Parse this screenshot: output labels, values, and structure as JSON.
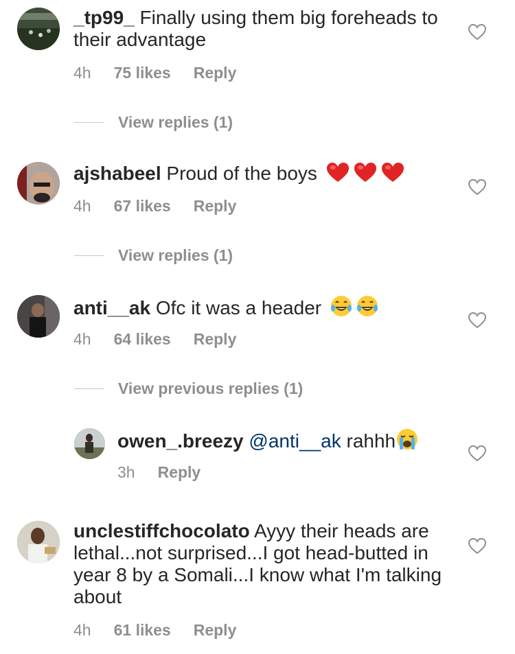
{
  "comments": [
    {
      "username": "_tp99_",
      "text": "Finally using them big foreheads to their advantage",
      "age": "4h",
      "likes": "75 likes",
      "reply": "Reply",
      "view_replies": "View replies (1)",
      "avatar_colors": [
        "#2c3b2a",
        "#7a8a73"
      ]
    },
    {
      "username": "ajshabeel",
      "text": "Proud of the boys",
      "emojis": [
        "red-heart",
        "red-heart",
        "red-heart"
      ],
      "age": "4h",
      "likes": "67 likes",
      "reply": "Reply",
      "view_replies": "View replies (1)",
      "avatar_colors": [
        "#b8ada6",
        "#2b2321"
      ]
    },
    {
      "username": "anti__ak",
      "text": "Ofc it was a header",
      "emojis": [
        "tears-of-joy",
        "tears-of-joy"
      ],
      "age": "4h",
      "likes": "64 likes",
      "reply": "Reply",
      "view_replies": "View previous replies (1)",
      "avatar_colors": [
        "#3a3636",
        "#151515"
      ]
    },
    {
      "username": "owen_.breezy",
      "mention": "@anti__ak",
      "text": "rahhh",
      "emojis": [
        "loudly-crying"
      ],
      "age": "3h",
      "reply": "Reply",
      "avatar_colors": [
        "#c9d0cf",
        "#3b3f2c"
      ]
    },
    {
      "username": "unclestiffchocolato",
      "text": "Ayyy their heads are lethal...not surprised...I got head-butted in year 8 by a Somali...I know what I'm talking about",
      "age": "4h",
      "likes": "61 likes",
      "reply": "Reply",
      "avatar_colors": [
        "#d9d6cf",
        "#5a3b25"
      ]
    }
  ],
  "colors": {
    "text": "#262626",
    "meta": "#8e8e8e",
    "mention": "#003569",
    "heart_outline": "#8e8e8e"
  }
}
